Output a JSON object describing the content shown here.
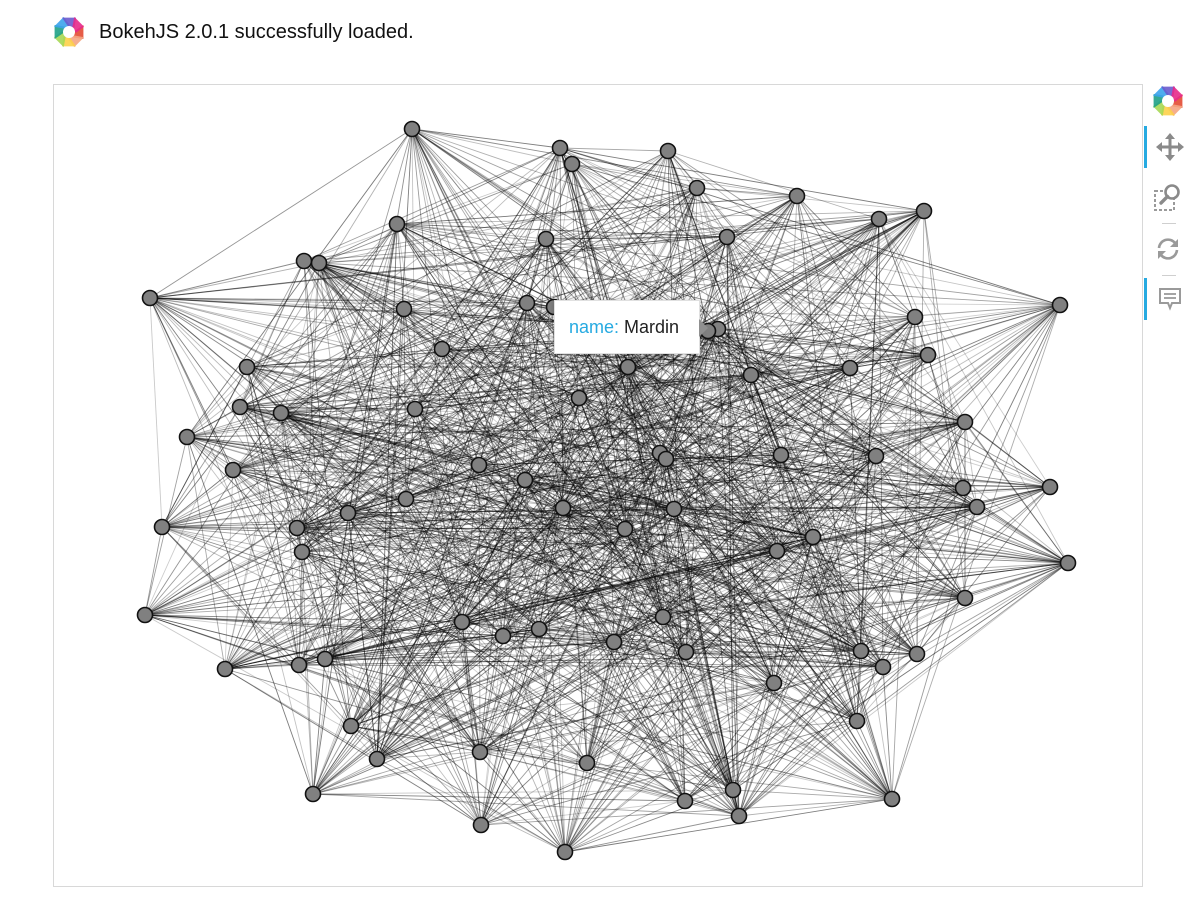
{
  "banner": {
    "message": "BokehJS 2.0.1 successfully loaded.",
    "logo_icon": "bokeh-logo-icon"
  },
  "toolbar": {
    "logo_icon": "bokeh-logo-icon",
    "tools": [
      {
        "name": "pan-tool",
        "icon": "pan-arrows-icon",
        "active": true
      },
      {
        "name": "box-zoom-tool",
        "icon": "box-zoom-icon",
        "active": false
      },
      {
        "name": "reset-tool",
        "icon": "reset-icon",
        "active": false
      },
      {
        "name": "hover-tool",
        "icon": "hover-tooltip-icon",
        "active": true
      }
    ],
    "accent_color": "#26aae1"
  },
  "tooltip": {
    "key": "name:",
    "value": "Mardin"
  },
  "graph": {
    "node_fill": "#808080",
    "node_stroke": "#111111",
    "edge_color": "#000000",
    "node_count": 95,
    "edge_count": 1765
  }
}
